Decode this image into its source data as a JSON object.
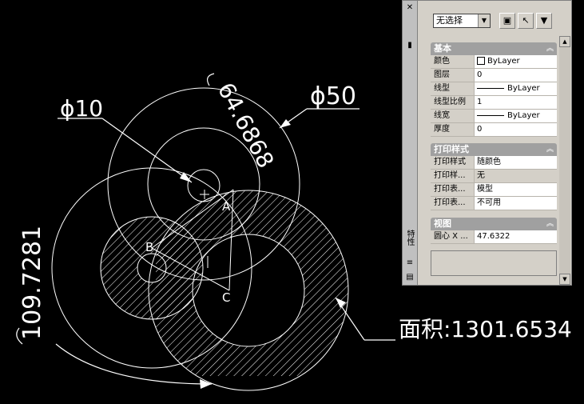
{
  "drawing": {
    "dim_diameter_small": "ϕ10",
    "dim_diameter_large": "ϕ50",
    "dim_arc_top": "64.6868",
    "dim_arc_left": "109.7281",
    "area_label": "面积:1301.6534",
    "point_a": "A",
    "point_b": "B",
    "point_c": "C"
  },
  "palette": {
    "selector_value": "无选择",
    "side_title": "特性",
    "sections": {
      "basic": {
        "title": "基本",
        "rows": [
          {
            "key": "颜色",
            "value": "ByLayer"
          },
          {
            "key": "图层",
            "value": "0"
          },
          {
            "key": "线型",
            "value": "ByLayer"
          },
          {
            "key": "线型比例",
            "value": "1"
          },
          {
            "key": "线宽",
            "value": "ByLayer"
          },
          {
            "key": "厚度",
            "value": "0"
          }
        ]
      },
      "print": {
        "title": "打印样式",
        "rows": [
          {
            "key": "打印样式",
            "value": "随颜色"
          },
          {
            "key": "打印样...",
            "value": "无"
          },
          {
            "key": "打印表...",
            "value": "模型"
          },
          {
            "key": "打印表...",
            "value": "不可用"
          }
        ]
      },
      "view": {
        "title": "视图",
        "rows": [
          {
            "key": "圆心 X ...",
            "value": "47.6322"
          }
        ]
      }
    }
  }
}
